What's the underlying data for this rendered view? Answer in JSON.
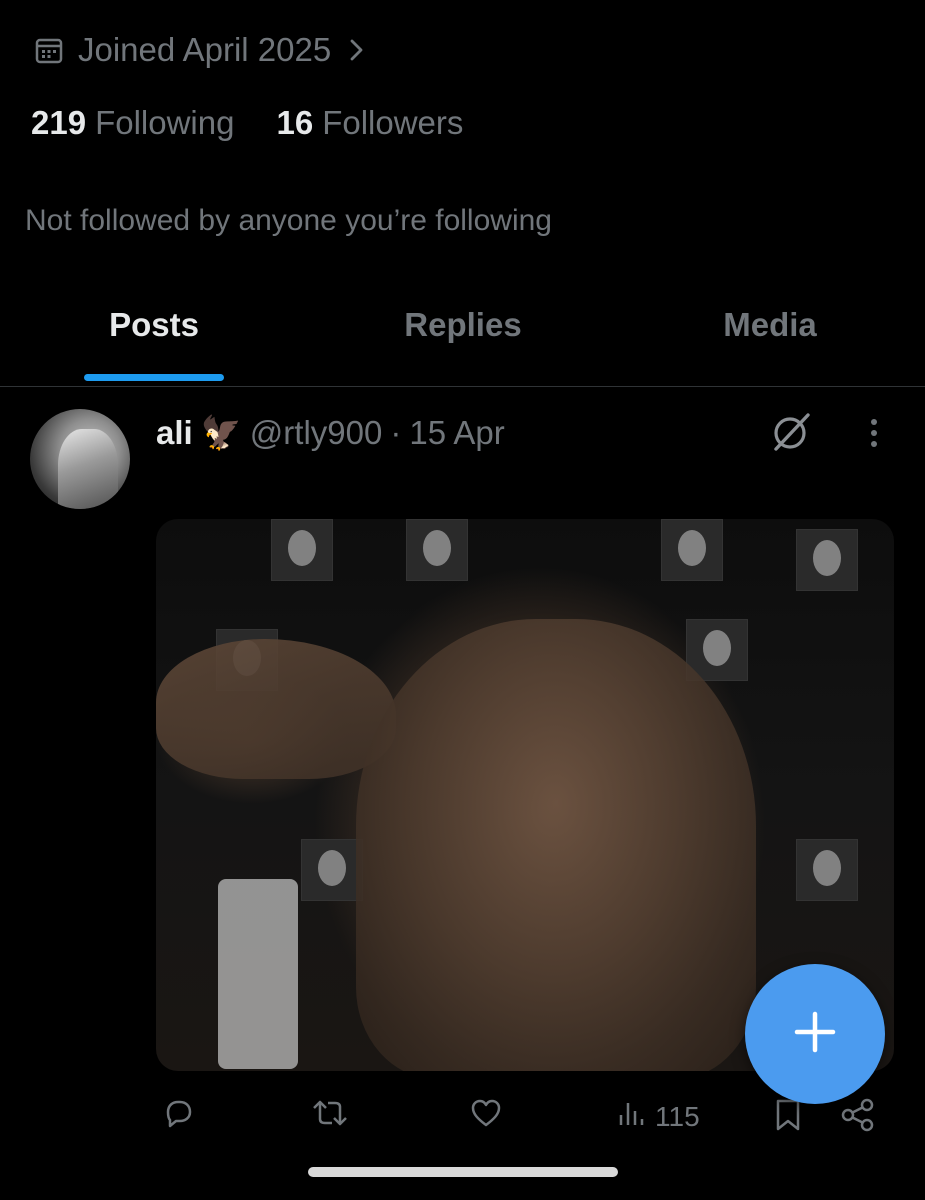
{
  "profile": {
    "joined": "Joined April 2025",
    "following_count": "219",
    "following_label": "Following",
    "followers_count": "16",
    "followers_label": "Followers",
    "not_followed": "Not followed by anyone you’re following"
  },
  "tabs": [
    {
      "label": "Posts",
      "active": true
    },
    {
      "label": "Replies",
      "active": false
    },
    {
      "label": "Media",
      "active": false
    }
  ],
  "post": {
    "name": "ali",
    "name_emoji": "🦅",
    "handle": "@rtly900",
    "separator": "·",
    "date": "15 Apr",
    "views": "115"
  },
  "colors": {
    "background": "#000000",
    "accent": "#1d9bf0",
    "fab": "#4b9bef",
    "muted_text": "#71767b"
  },
  "icons": {
    "joined": "calendar-icon",
    "joined_chevron": "chevron-right-icon",
    "grok": "grok-icon",
    "more": "more-vertical-icon",
    "reply": "reply-icon",
    "repost": "repost-icon",
    "like": "like-icon",
    "views": "views-icon",
    "bookmark": "bookmark-icon",
    "share": "share-icon",
    "fab": "plus-icon"
  }
}
